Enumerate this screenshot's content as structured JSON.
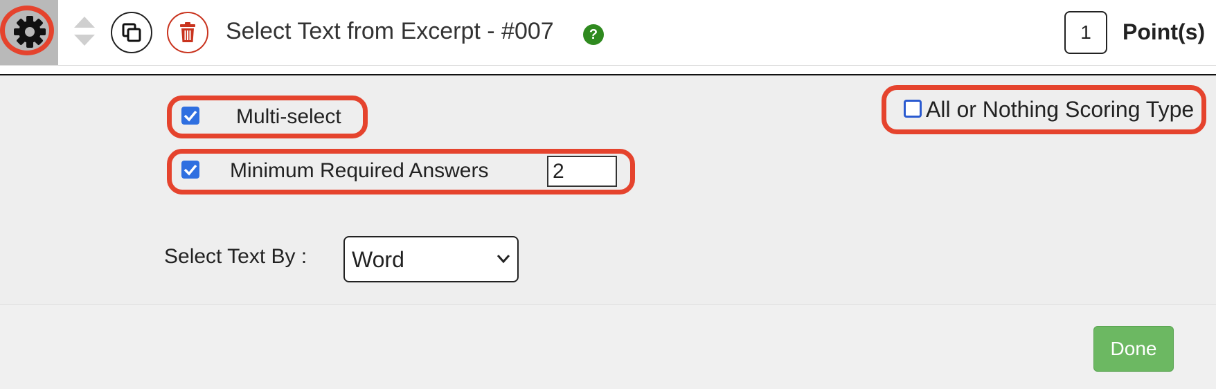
{
  "header": {
    "title": "Select Text from Excerpt - #007",
    "points_value": "1",
    "points_label": "Point(s)"
  },
  "icons": {
    "gear": "gear-icon",
    "sort": "sort-arrows-icon",
    "copy": "copy-icon",
    "delete": "trash-icon",
    "help": "help-icon"
  },
  "options": {
    "multi_select": {
      "label": "Multi-select",
      "checked": true
    },
    "min_required": {
      "label": "Minimum Required Answers",
      "checked": true,
      "value": "2"
    },
    "all_or_nothing": {
      "label": "All or Nothing Scoring Type",
      "checked": false
    },
    "select_by": {
      "label": "Select Text By :",
      "value": "Word"
    }
  },
  "footer": {
    "done_label": "Done"
  },
  "colors": {
    "highlight": "#e5432d",
    "checkbox": "#2f6fe0",
    "done": "#6cb862",
    "help": "#2f8a1f",
    "delete": "#c9341f"
  }
}
